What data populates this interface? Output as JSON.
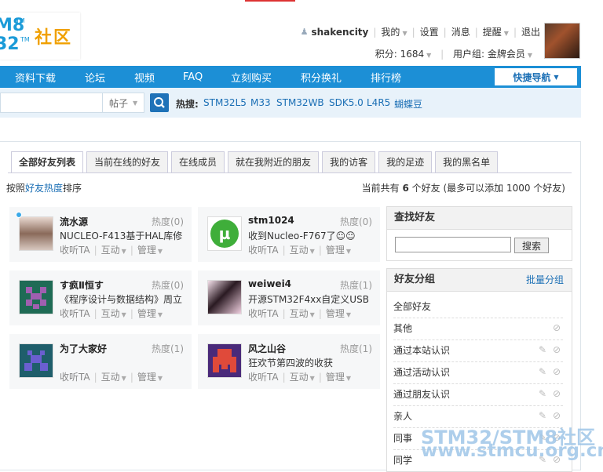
{
  "header": {
    "logo": {
      "stm8": "M8",
      "stm32": "32",
      "tm": "TM",
      "community": "社区"
    },
    "user": {
      "username": "shakencity",
      "mine": "我的",
      "settings": "设置",
      "messages": "消息",
      "reminders": "提醒",
      "logout": "退出",
      "points": "积分: 1684",
      "group": "用户组: 金牌会员"
    }
  },
  "nav": {
    "items": [
      "资料下载",
      "论坛",
      "视频",
      "FAQ",
      "立刻购买",
      "积分换礼",
      "排行榜"
    ],
    "quick_nav": "快捷导航"
  },
  "search": {
    "select_value": "帖子",
    "hot_label": "热搜:",
    "hot_terms": [
      "STM32L5",
      "M33",
      "STM32WB",
      "SDK5.0",
      "L4R5",
      "蝴蝶豆"
    ]
  },
  "tabs": [
    "全部好友列表",
    "当前在线的好友",
    "在线成员",
    "就在我附近的朋友",
    "我的访客",
    "我的足迹",
    "我的黑名单"
  ],
  "sort": {
    "prefix": "按照",
    "key": "好友热度",
    "suffix": "排序"
  },
  "count_info": {
    "prefix": "当前共有",
    "count": "6",
    "suffix": "个好友 (最多可以添加 1000 个好友)"
  },
  "friends": [
    {
      "name": "流水源",
      "heat": "热度(0)",
      "msg": "NUCLEO-F413基于HAL库修",
      "a1": "收听TA",
      "a2": "互动",
      "a3": "管理"
    },
    {
      "name": "stm1024",
      "heat": "热度(0)",
      "msg": "收到Nucleo-F767了☺☺",
      "a1": "收听TA",
      "a2": "互动",
      "a3": "管理"
    },
    {
      "name": "す疯Ⅱ恒す",
      "heat": "热度(0)",
      "msg": "《程序设计与数据结构》周立",
      "a1": "收听TA",
      "a2": "互动",
      "a3": "管理"
    },
    {
      "name": "weiwei4",
      "heat": "热度(1)",
      "msg": "开源STM32F4xx自定义USB",
      "a1": "收听TA",
      "a2": "互动",
      "a3": "管理"
    },
    {
      "name": "为了大家好",
      "heat": "热度(1)",
      "msg": "",
      "a1": "收听TA",
      "a2": "互动",
      "a3": "管理"
    },
    {
      "name": "风之山谷",
      "heat": "热度(1)",
      "msg": "狂欢节第四波的收获",
      "a1": "收听TA",
      "a2": "互动",
      "a3": "管理"
    }
  ],
  "find_friend": {
    "title": "查找好友",
    "button": "搜索"
  },
  "friend_groups": {
    "title": "好友分组",
    "batch": "批量分组",
    "items": [
      "全部好友",
      "其他",
      "通过本站认识",
      "通过活动认识",
      "通过朋友认识",
      "亲人",
      "同事",
      "同学"
    ]
  },
  "watermark": {
    "line1": "STM32/STM8社区",
    "line2": "www.stmcu.org.cn"
  },
  "colors": {
    "nav": "#1c8fd6",
    "link": "#1b6fb5",
    "search_bar": "#e8f2fa"
  }
}
